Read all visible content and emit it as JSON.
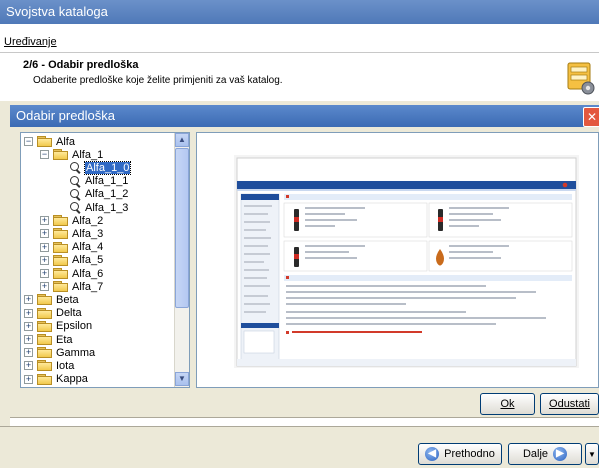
{
  "window": {
    "title": "Svojstva kataloga"
  },
  "menu": {
    "items": [
      "Uređivanje"
    ]
  },
  "step": {
    "title": "2/6 - Odabir predloška",
    "description": "Odaberite predloške koje želite primjeniti za vaš katalog."
  },
  "dialog": {
    "title": "Odabir predloška",
    "close_label": "✕",
    "ok_label": "Ok",
    "cancel_label": "Odustati"
  },
  "tree": {
    "items": [
      {
        "label": "Alfa",
        "level": 0,
        "toggle": "−",
        "icon": "folder-icon"
      },
      {
        "label": "Alfa_1",
        "level": 1,
        "toggle": "−",
        "icon": "folder-icon"
      },
      {
        "label": "Alfa_1_0",
        "level": 2,
        "toggle": "",
        "icon": "magnifier-icon",
        "selected": true
      },
      {
        "label": "Alfa_1_1",
        "level": 2,
        "toggle": "",
        "icon": "magnifier-icon"
      },
      {
        "label": "Alfa_1_2",
        "level": 2,
        "toggle": "",
        "icon": "magnifier-icon"
      },
      {
        "label": "Alfa_1_3",
        "level": 2,
        "toggle": "",
        "icon": "magnifier-icon"
      },
      {
        "label": "Alfa_2",
        "level": 1,
        "toggle": "+",
        "icon": "folder-icon"
      },
      {
        "label": "Alfa_3",
        "level": 1,
        "toggle": "+",
        "icon": "folder-icon"
      },
      {
        "label": "Alfa_4",
        "level": 1,
        "toggle": "+",
        "icon": "folder-icon"
      },
      {
        "label": "Alfa_5",
        "level": 1,
        "toggle": "+",
        "icon": "folder-icon"
      },
      {
        "label": "Alfa_6",
        "level": 1,
        "toggle": "+",
        "icon": "folder-icon"
      },
      {
        "label": "Alfa_7",
        "level": 1,
        "toggle": "+",
        "icon": "folder-icon"
      },
      {
        "label": "Beta",
        "level": 0,
        "toggle": "+",
        "icon": "folder-icon"
      },
      {
        "label": "Delta",
        "level": 0,
        "toggle": "+",
        "icon": "folder-icon"
      },
      {
        "label": "Epsilon",
        "level": 0,
        "toggle": "+",
        "icon": "folder-icon"
      },
      {
        "label": "Eta",
        "level": 0,
        "toggle": "+",
        "icon": "folder-icon"
      },
      {
        "label": "Gamma",
        "level": 0,
        "toggle": "+",
        "icon": "folder-icon"
      },
      {
        "label": "Iota",
        "level": 0,
        "toggle": "+",
        "icon": "folder-icon"
      },
      {
        "label": "Kappa",
        "level": 0,
        "toggle": "+",
        "icon": "folder-icon"
      }
    ]
  },
  "preview": {
    "nav_items": [
      "Home",
      "Proizvodi",
      "Novosti",
      "Kontakt",
      "Info"
    ],
    "nav_colors": {
      "nav": "#1f4e9c",
      "accent": "#d23a2a"
    }
  },
  "footer": {
    "back_label": "Prethodno",
    "next_label": "Dalje"
  },
  "colors": {
    "titlebar": "#4f79b8",
    "selection": "#316ac5",
    "panel_bg": "#ece9d8"
  }
}
